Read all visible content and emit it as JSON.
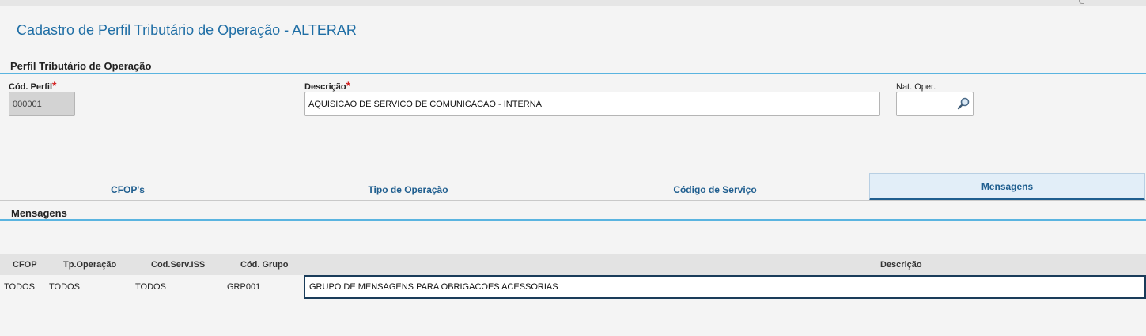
{
  "page": {
    "title": "Cadastro de Perfil Tributário de Operação - ALTERAR"
  },
  "section": {
    "title": "Perfil Tributário de Operação"
  },
  "form": {
    "cod_perfil": {
      "label": "Cód. Perfil",
      "required_mark": "*",
      "value": "000001"
    },
    "descricao": {
      "label": "Descrição",
      "required_mark": "*",
      "value": "AQUISICAO DE SERVICO DE COMUNICACAO - INTERNA"
    },
    "nat_oper": {
      "label": "Nat. Oper.",
      "value": "",
      "icon": "search-icon"
    }
  },
  "tabs": [
    {
      "label": "CFOP's",
      "active": false
    },
    {
      "label": "Tipo de Operação",
      "active": false
    },
    {
      "label": "Código de Serviço",
      "active": false
    },
    {
      "label": "Mensagens",
      "active": true
    }
  ],
  "messages_section": {
    "title": "Mensagens",
    "columns": [
      "CFOP",
      "Tp.Operação",
      "Cod.Serv.ISS",
      "Cód. Grupo",
      "Descrição"
    ],
    "rows": [
      [
        "TODOS",
        "TODOS",
        "TODOS",
        "GRP001",
        "GRUPO DE MENSAGENS PARA OBRIGACOES ACESSORIAS"
      ]
    ]
  },
  "colors": {
    "title": "#1f6ea5",
    "accent_line": "#5ab4e0",
    "required": "#d21f1f",
    "tab_text": "#1f5e8f",
    "active_tab_bg": "#e2eef8"
  }
}
